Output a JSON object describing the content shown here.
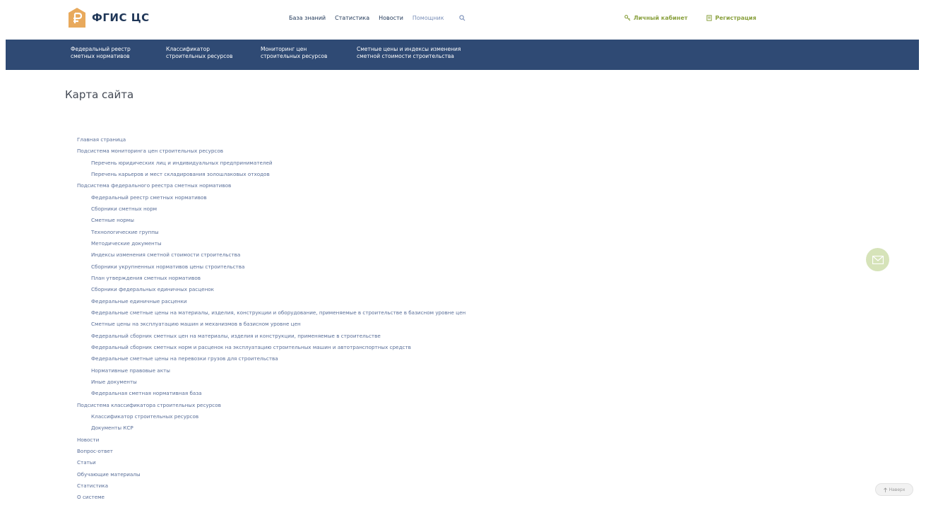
{
  "header": {
    "logo_text": "ФГИС ЦС",
    "nav": [
      "База знаний",
      "Статистика",
      "Новости"
    ],
    "search_placeholder": "Помощник",
    "account_label": "Личный кабинет",
    "register_label": "Регистрация"
  },
  "main_nav": [
    "Федеральный реестр\nсметных нормативов",
    "Классификатор\nстроительных ресурсов",
    "Мониторинг цен\nстроительных ресурсов",
    "Сметные цены и индексы изменения\nсметной стоимости строительства"
  ],
  "page_title": "Карта сайта",
  "sitemap": [
    {
      "label": "Главная страница",
      "level": 1
    },
    {
      "label": "Подсистема мониторинга цен строительных ресурсов",
      "level": 1
    },
    {
      "label": "Перечень юридических лиц и индивидуальных предпринимателей",
      "level": 2
    },
    {
      "label": "Перечень карьеров и мест складирования золошлаковых отходов",
      "level": 2
    },
    {
      "label": "Подсистема федерального реестра сметных нормативов",
      "level": 1
    },
    {
      "label": "Федеральный реестр сметных нормативов",
      "level": 2
    },
    {
      "label": "Сборники сметных норм",
      "level": 2
    },
    {
      "label": "Сметные нормы",
      "level": 2
    },
    {
      "label": "Технологические группы",
      "level": 2
    },
    {
      "label": "Методические документы",
      "level": 2
    },
    {
      "label": "Индексы изменения сметной стоимости строительства",
      "level": 2
    },
    {
      "label": "Сборники укрупненных нормативов цены строительства",
      "level": 2
    },
    {
      "label": "План утверждения сметных нормативов",
      "level": 2
    },
    {
      "label": "Сборники федеральных единичных расценок",
      "level": 2
    },
    {
      "label": "Федеральные единичные расценки",
      "level": 2
    },
    {
      "label": "Федеральные сметные цены на материалы, изделия, конструкции и оборудование, применяемые в строительстве в базисном уровне цен",
      "level": 2
    },
    {
      "label": "Сметные цены на эксплуатацию машин и механизмов в базисном уровне цен",
      "level": 2
    },
    {
      "label": "Федеральный сборник сметных цен на материалы, изделия и конструкции, применяемые в строительстве",
      "level": 2
    },
    {
      "label": "Федеральный сборник сметных норм и расценок на эксплуатацию строительных машин и автотранспортных средств",
      "level": 2
    },
    {
      "label": "Федеральные сметные цены на перевозки грузов для строительства",
      "level": 2
    },
    {
      "label": "Нормативные правовые акты",
      "level": 2
    },
    {
      "label": "Иные документы",
      "level": 2
    },
    {
      "label": "Федеральная сметная нормативная база",
      "level": 2
    },
    {
      "label": "Подсистема классификатора строительных ресурсов",
      "level": 1
    },
    {
      "label": "Классификатор строительных ресурсов",
      "level": 2
    },
    {
      "label": "Документы КСР",
      "level": 2
    },
    {
      "label": "Новости",
      "level": 1
    },
    {
      "label": "Вопрос-ответ",
      "level": 1
    },
    {
      "label": "Статьи",
      "level": 1
    },
    {
      "label": "Обучающие материалы",
      "level": 1
    },
    {
      "label": "Статистика",
      "level": 1
    },
    {
      "label": "О системе",
      "level": 1
    }
  ],
  "to_top_label": "Наверх",
  "icons": {
    "logo": "ruble-house-icon",
    "search": "search-icon",
    "account": "key-icon",
    "register": "register-icon",
    "mail": "mail-icon",
    "to_top": "arrow-up-icon"
  },
  "colors": {
    "brand_dark": "#1f3657",
    "nav_bg": "#2f4a74",
    "accent_green": "#8aa13f",
    "logo_orange": "#e8a95c",
    "link": "#5a6f99"
  }
}
